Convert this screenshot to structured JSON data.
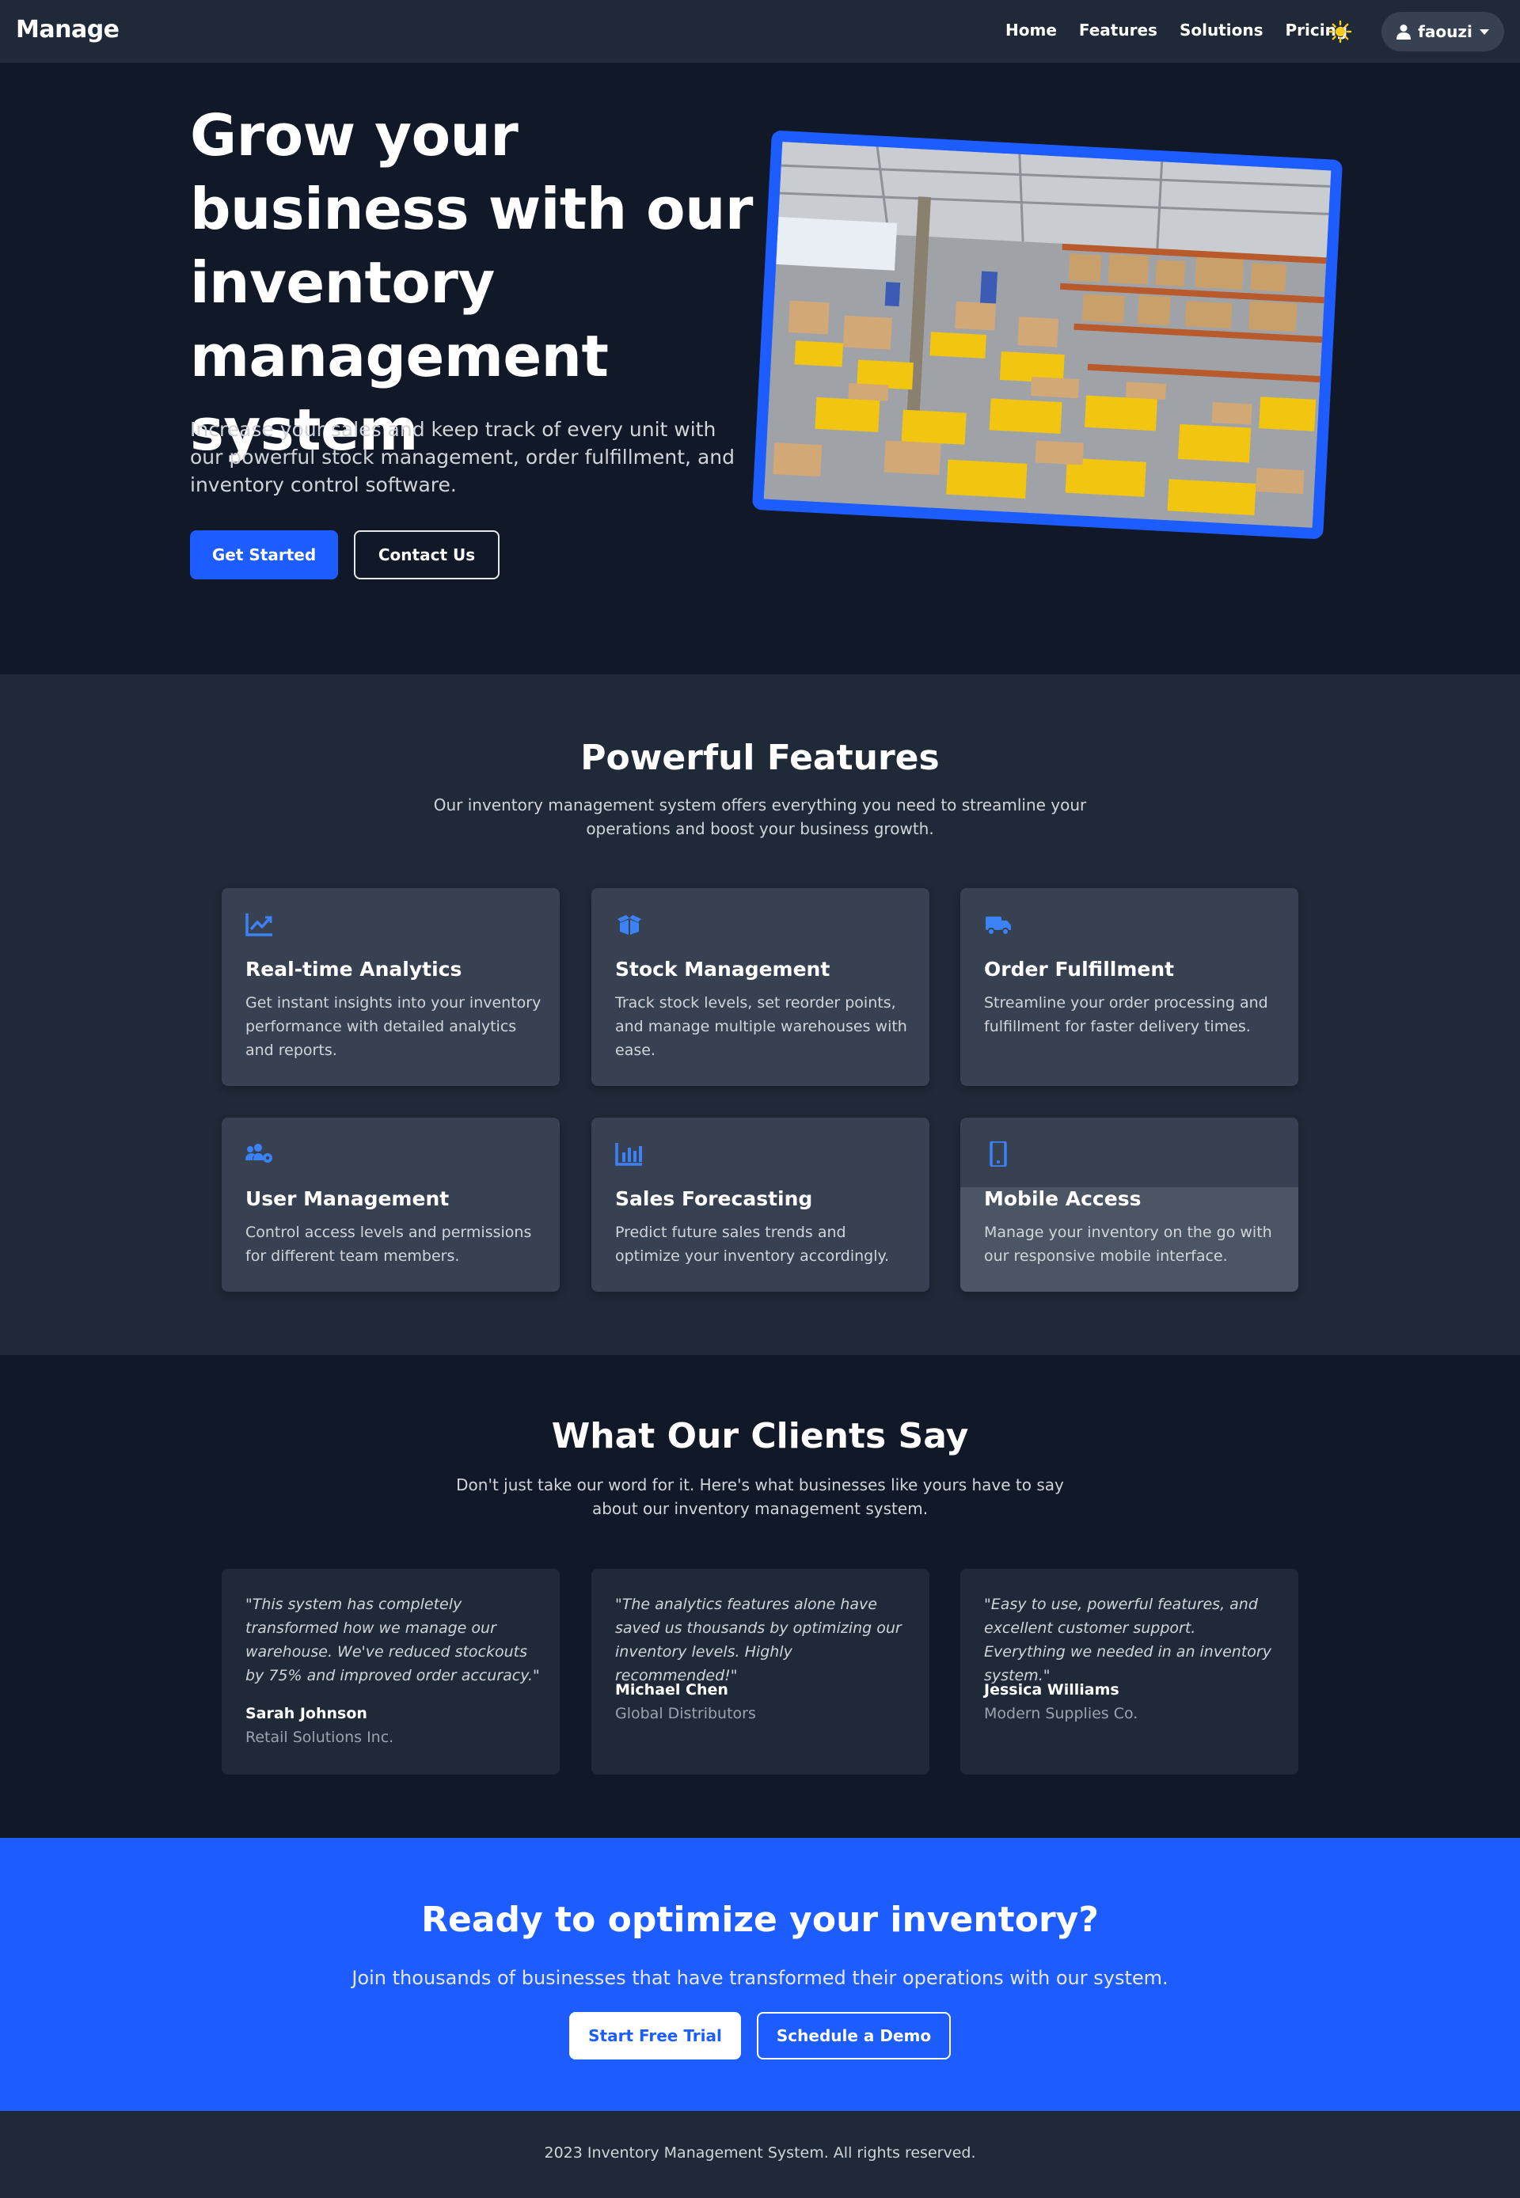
{
  "nav": {
    "brand": "Manage",
    "links": [
      "Home",
      "Features",
      "Solutions",
      "Pricing"
    ],
    "user_name": "faouzi",
    "theme_icon": "sun-icon",
    "user_icon": "user-icon"
  },
  "hero": {
    "title": "Grow your business with our inventory management system",
    "subtitle": "Increase your sales and keep track of every unit with our powerful stock management, order fulfillment, and inventory control software.",
    "primary_button": "Get Started",
    "secondary_button": "Contact Us"
  },
  "features": {
    "title": "Powerful Features",
    "subtitle": "Our inventory management system offers everything you need to streamline your operations and boost your business growth.",
    "items": [
      {
        "icon": "chart-line-icon",
        "title": "Real-time Analytics",
        "text": "Get instant insights into your inventory performance with detailed analytics and reports."
      },
      {
        "icon": "boxes-icon",
        "title": "Stock Management",
        "text": "Track stock levels, set reorder points, and manage multiple warehouses with ease."
      },
      {
        "icon": "truck-icon",
        "title": "Order Fulfillment",
        "text": "Streamline your order processing and fulfillment for faster delivery times."
      },
      {
        "icon": "users-cog-icon",
        "title": "User Management",
        "text": "Control access levels and permissions for different team members."
      },
      {
        "icon": "bar-chart-icon",
        "title": "Sales Forecasting",
        "text": "Predict future sales trends and optimize your inventory accordingly."
      },
      {
        "icon": "mobile-icon",
        "title": "Mobile Access",
        "text": "Manage your inventory on the go with our responsive mobile interface."
      }
    ]
  },
  "testimonials": {
    "title": "What Our Clients Say",
    "subtitle": "Don't just take our word for it. Here's what businesses like yours have to say about our inventory management system.",
    "items": [
      {
        "quote": "\"This system has completely transformed how we manage our warehouse. We've reduced stockouts by 75% and improved order accuracy.\"",
        "name": "Sarah Johnson",
        "company": "Retail Solutions Inc."
      },
      {
        "quote": "\"The analytics features alone have saved us thousands by optimizing our inventory levels. Highly recommended!\"",
        "name": "Michael Chen",
        "company": "Global Distributors"
      },
      {
        "quote": "\"Easy to use, powerful features, and excellent customer support. Everything we needed in an inventory system.\"",
        "name": "Jessica Williams",
        "company": "Modern Supplies Co."
      }
    ]
  },
  "cta": {
    "title": "Ready to optimize your inventory?",
    "subtitle": "Join thousands of businesses that have transformed their operations with our system.",
    "primary_button": "Start Free Trial",
    "secondary_button": "Schedule a Demo"
  },
  "footer": {
    "text": "2023 Inventory Management System. All rights reserved."
  },
  "colors": {
    "accent": "#1d5cff",
    "background": "#111827",
    "surface": "#1f2937",
    "card": "#374151"
  }
}
